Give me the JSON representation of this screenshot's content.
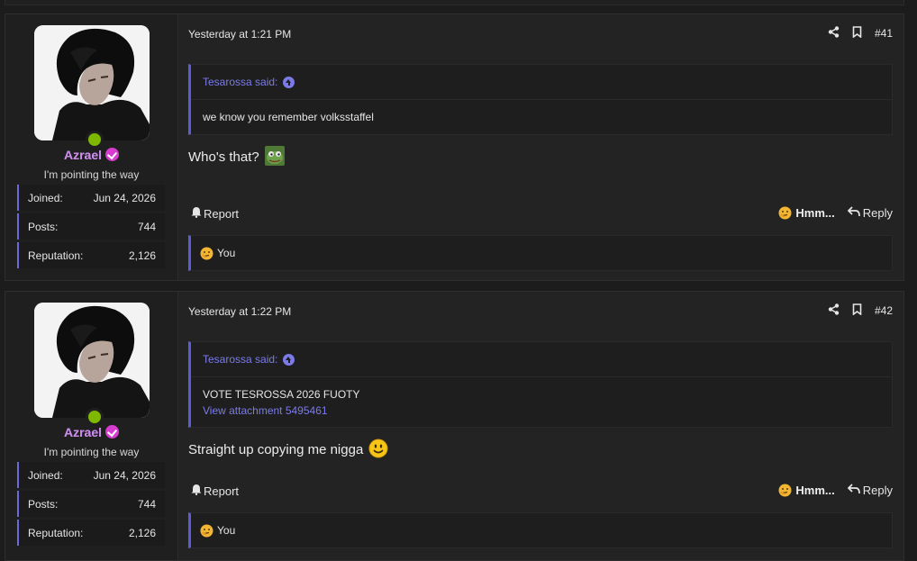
{
  "posts": [
    {
      "user": {
        "name": "Azrael",
        "title": "I'm pointing the way",
        "stats": [
          {
            "label": "Joined:",
            "value": "Jun 24, 2026"
          },
          {
            "label": "Posts:",
            "value": "744"
          },
          {
            "label": "Reputation:",
            "value": "2,126"
          }
        ]
      },
      "date": "Yesterday at 1:21 PM",
      "number": "#41",
      "quote": {
        "author": "Tesarossa said:",
        "lines": [
          "we know you remember volksstaffel"
        ],
        "link": ""
      },
      "message": "Who's that?",
      "message_emoji": "pepe-emoji",
      "report": "Report",
      "reaction": "Hmm...",
      "reply": "Reply",
      "reactions_by": "You"
    },
    {
      "user": {
        "name": "Azrael",
        "title": "I'm pointing the way",
        "stats": [
          {
            "label": "Joined:",
            "value": "Jun 24, 2026"
          },
          {
            "label": "Posts:",
            "value": "744"
          },
          {
            "label": "Reputation:",
            "value": "2,126"
          }
        ]
      },
      "date": "Yesterday at 1:22 PM",
      "number": "#42",
      "quote": {
        "author": "Tesarossa said:",
        "lines": [
          "VOTE TESROSSA 2026 FUOTY"
        ],
        "link": "View attachment 5495461"
      },
      "message": "Straight up copying me nigga",
      "message_emoji": "smile-emoji",
      "report": "Report",
      "reaction": "Hmm...",
      "reply": "Reply",
      "reactions_by": "You"
    }
  ],
  "colors": {
    "accent": "#5c5cd6",
    "link": "#7b7be8",
    "online": "#7fb800",
    "verified": "#d83bd0"
  }
}
